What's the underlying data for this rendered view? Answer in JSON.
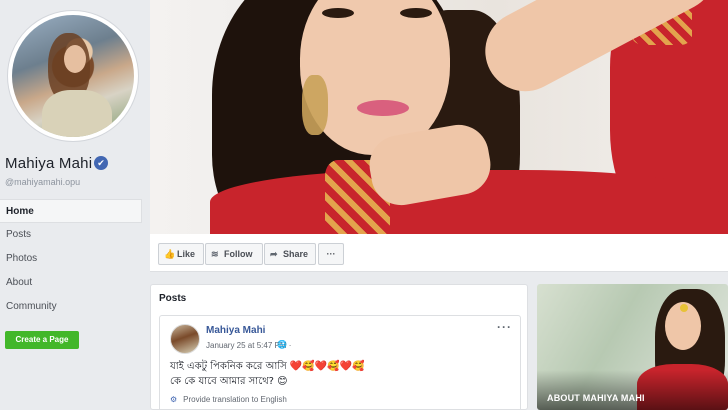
{
  "profile": {
    "name": "Mahiya Mahi",
    "handle": "@mahiyamahi.opu",
    "verified_mark": "✔"
  },
  "sidebar": {
    "items": [
      {
        "label": "Home",
        "active": true
      },
      {
        "label": "Posts"
      },
      {
        "label": "Photos"
      },
      {
        "label": "About"
      },
      {
        "label": "Community"
      }
    ],
    "create_page_label": "Create a Page"
  },
  "actions": {
    "like": "Like",
    "follow": "Follow",
    "share": "Share",
    "more": "···",
    "like_icon": "thumbs-up-icon",
    "follow_icon": "rss-icon",
    "share_icon": "share-arrow-icon"
  },
  "posts": {
    "title": "Posts",
    "items": [
      {
        "author": "Mahiya Mahi",
        "time": "January 25 at 5:47 PM ·",
        "line1": "যাই একটু পিকনিক করে আসি ❤️🥰❤️🥰❤️🥰",
        "line2": "কে কে যাবে আমার সাথে? 😊",
        "translate": "Provide translation to English",
        "menu": "···"
      }
    ]
  },
  "about": {
    "label": "ABOUT MAHIYA MAHI"
  },
  "colors": {
    "brand_blue": "#4267b2",
    "create_green": "#42b72a",
    "background": "#e9ebee"
  }
}
